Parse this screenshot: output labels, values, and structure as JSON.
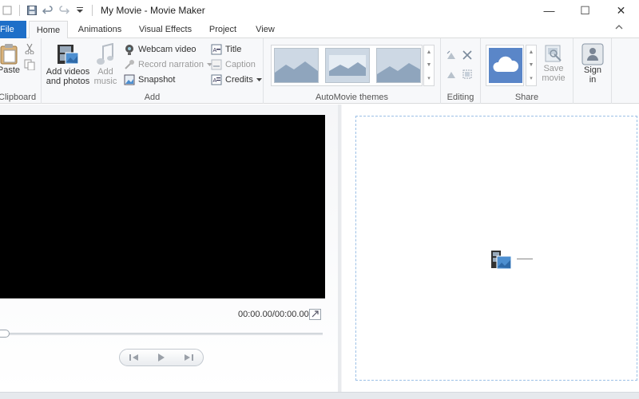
{
  "window": {
    "title": "My Movie - Movie Maker",
    "controls": {
      "minimize": "—",
      "maximize": "☐",
      "close": "✕"
    }
  },
  "tabs": [
    {
      "label": "File"
    },
    {
      "label": "Home"
    },
    {
      "label": "Animations"
    },
    {
      "label": "Visual Effects"
    },
    {
      "label": "Project"
    },
    {
      "label": "View"
    }
  ],
  "ribbon": {
    "clipboard": {
      "label": "Clipboard",
      "paste": "Paste"
    },
    "add": {
      "label": "Add",
      "add_videos": [
        "Add videos",
        "and photos"
      ],
      "add_music": [
        "Add",
        "music"
      ],
      "webcam_video": "Webcam video",
      "record_narration": "Record narration",
      "snapshot": "Snapshot",
      "title": "Title",
      "caption": "Caption",
      "credits": "Credits"
    },
    "automovie": {
      "label": "AutoMovie themes"
    },
    "editing": {
      "label": "Editing"
    },
    "share": {
      "label": "Share",
      "save_movie": [
        "Save",
        "movie"
      ]
    },
    "signin": {
      "label": [
        "Sign",
        "in"
      ]
    }
  },
  "preview": {
    "timecode": "00:00.00/00:00.00"
  },
  "colors": {
    "file_tab": "#1e6fc8",
    "video_bg": "#000000",
    "cloud_tile": "#5a86c8",
    "drop_border": "#9cc0e6"
  }
}
